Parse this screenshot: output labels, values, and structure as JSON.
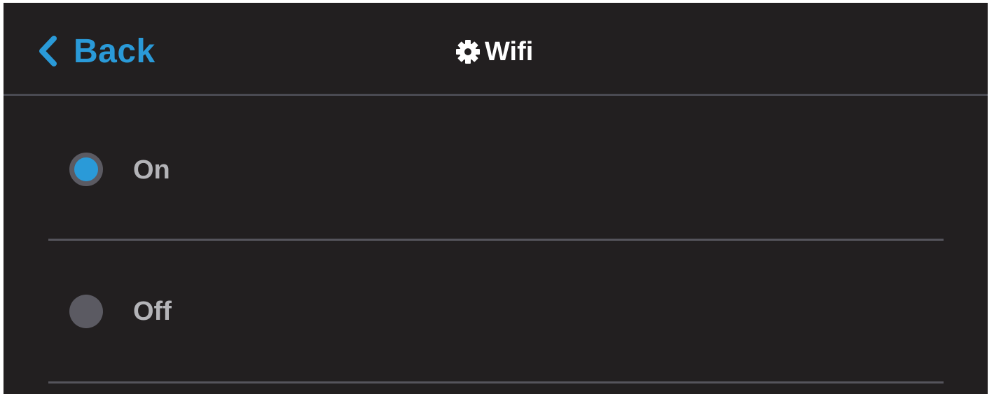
{
  "header": {
    "back_label": "Back",
    "title": "Wifi",
    "title_icon": "gear-icon",
    "back_icon": "chevron-left-icon"
  },
  "options": [
    {
      "label": "On",
      "selected": true
    },
    {
      "label": "Off",
      "selected": false
    }
  ],
  "colors": {
    "background": "#221f20",
    "accent": "#2a9ad8",
    "divider": "#55545c",
    "radio_inactive": "#5b5a62",
    "option_text": "#b4b4b8",
    "title_text": "#ffffff"
  }
}
